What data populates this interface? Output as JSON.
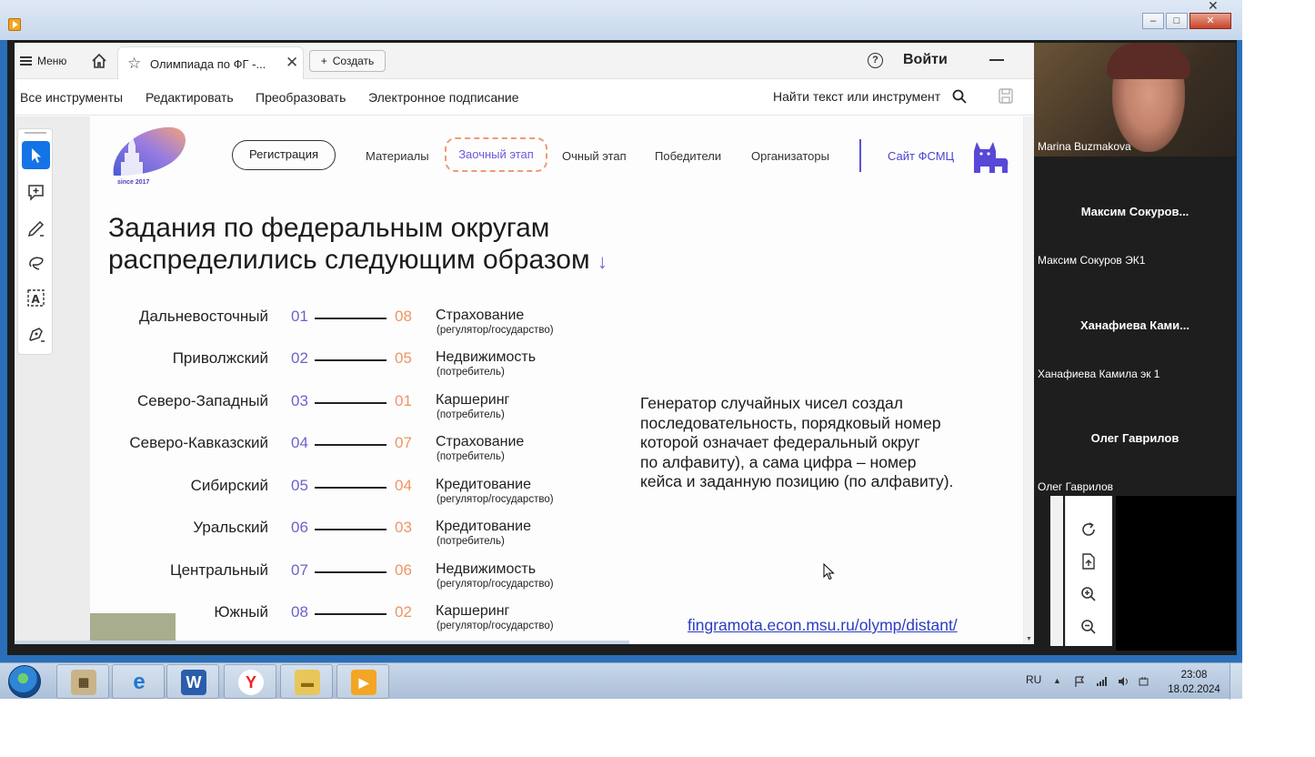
{
  "acrobat": {
    "menu_label": "Меню",
    "tab_title": "Олимпиада по ФГ -...",
    "create_label": "Создать",
    "signin_label": "Войти",
    "tools": [
      "Все инструменты",
      "Редактировать",
      "Преобразовать",
      "Электронное подписание"
    ],
    "find_label": "Найти текст или инструмент"
  },
  "slide": {
    "logo_since": "since 2017",
    "nav": {
      "registration": "Регистрация",
      "materials": "Материалы",
      "correspondence": "Заочный этап",
      "fulltime": "Очный этап",
      "winners": "Победители",
      "organizers": "Организаторы",
      "site": "Сайт ФСМЦ"
    },
    "heading_line1": "Задания по федеральным округам",
    "heading_line2": "распределились следующим образом",
    "heading_arrow": "↓",
    "rows": [
      {
        "region": "Дальневосточный",
        "n1": "01",
        "n2": "08",
        "case": "Страхование",
        "sub": "(регулятор/государство)"
      },
      {
        "region": "Приволжский",
        "n1": "02",
        "n2": "05",
        "case": "Недвижимость",
        "sub": "(потребитель)"
      },
      {
        "region": "Северо-Западный",
        "n1": "03",
        "n2": "01",
        "case": "Каршеринг",
        "sub": "(потребитель)"
      },
      {
        "region": "Северо-Кавказский",
        "n1": "04",
        "n2": "07",
        "case": "Страхование",
        "sub": "(потребитель)"
      },
      {
        "region": "Сибирский",
        "n1": "05",
        "n2": "04",
        "case": "Кредитование",
        "sub": "(регулятор/государство)"
      },
      {
        "region": "Уральский",
        "n1": "06",
        "n2": "03",
        "case": "Кредитование",
        "sub": "(потребитель)"
      },
      {
        "region": "Центральный",
        "n1": "07",
        "n2": "06",
        "case": "Недвижимость",
        "sub": "(регулятор/государство)"
      },
      {
        "region": "Южный",
        "n1": "08",
        "n2": "02",
        "case": "Каршеринг",
        "sub": "(регулятор/государство)"
      }
    ],
    "generator_lines": [
      "Генератор случайных чисел создал",
      "последовательность, порядковый номер",
      "которой означает федеральный округ",
      "по алфавиту), а сама цифра – номер",
      "кейса и заданную позицию (по алфавиту)."
    ],
    "link": "fingramota.econ.msu.ru/olymp/distant/"
  },
  "participants": [
    {
      "video_name": "Marina Buzmakova"
    },
    {
      "big_name": "Максим  Сокуров...",
      "small_name": "Максим Сокуров ЭК1"
    },
    {
      "big_name": "Ханафиева  Ками...",
      "small_name": "Ханафиева Камила эк 1"
    },
    {
      "big_name": "Олег Гаврилов",
      "small_name": "Олег Гаврилов"
    }
  ],
  "taskbar": {
    "lang": "RU",
    "time": "23:08",
    "date": "18.02.2024"
  },
  "colors": {
    "accent_purple": "#6b63cc",
    "accent_orange": "#ef9563",
    "acrobat_blue": "#1473e6"
  }
}
